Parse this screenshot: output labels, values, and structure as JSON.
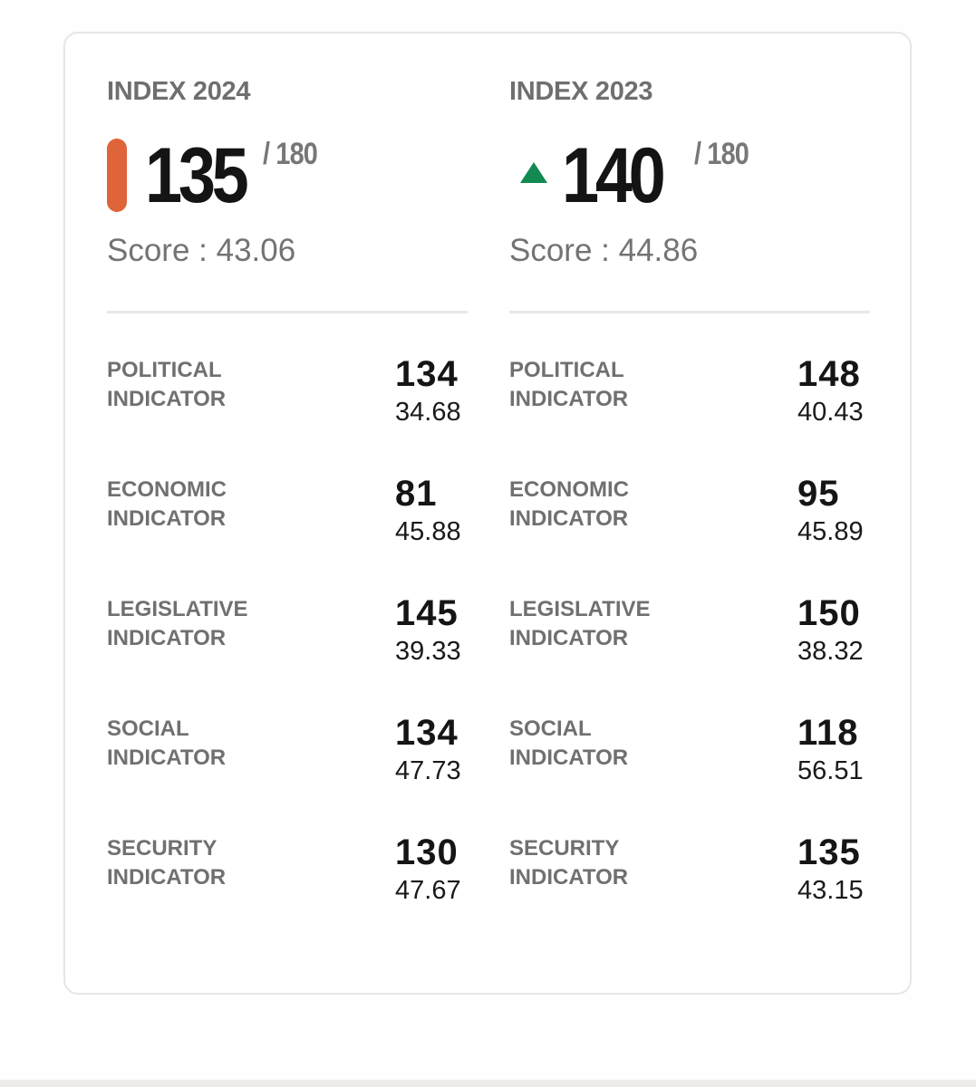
{
  "colors": {
    "marker_2024": "#e0643a",
    "marker_2023_up": "#138a52"
  },
  "columns": [
    {
      "title": "INDEX 2024",
      "rank": "135",
      "total": "/ 180",
      "score_label": "Score : 43.06",
      "marker": "orange-bar",
      "indicators": [
        {
          "label": "POLITICAL INDICATOR",
          "rank": "134",
          "score": "34.68"
        },
        {
          "label": "ECONOMIC INDICATOR",
          "rank": "81",
          "score": "45.88"
        },
        {
          "label": "LEGISLATIVE INDICATOR",
          "rank": "145",
          "score": "39.33"
        },
        {
          "label": "SOCIAL INDICATOR",
          "rank": "134",
          "score": "47.73"
        },
        {
          "label": "SECURITY INDICATOR",
          "rank": "130",
          "score": "47.67"
        }
      ]
    },
    {
      "title": "INDEX 2023",
      "rank": "140",
      "total": "/ 180",
      "score_label": "Score : 44.86",
      "marker": "up-triangle",
      "indicators": [
        {
          "label": "POLITICAL INDICATOR",
          "rank": "148",
          "score": "40.43"
        },
        {
          "label": "ECONOMIC INDICATOR",
          "rank": "95",
          "score": "45.89"
        },
        {
          "label": "LEGISLATIVE INDICATOR",
          "rank": "150",
          "score": "38.32"
        },
        {
          "label": "SOCIAL INDICATOR",
          "rank": "118",
          "score": "56.51"
        },
        {
          "label": "SECURITY INDICATOR",
          "rank": "135",
          "score": "43.15"
        }
      ]
    }
  ]
}
